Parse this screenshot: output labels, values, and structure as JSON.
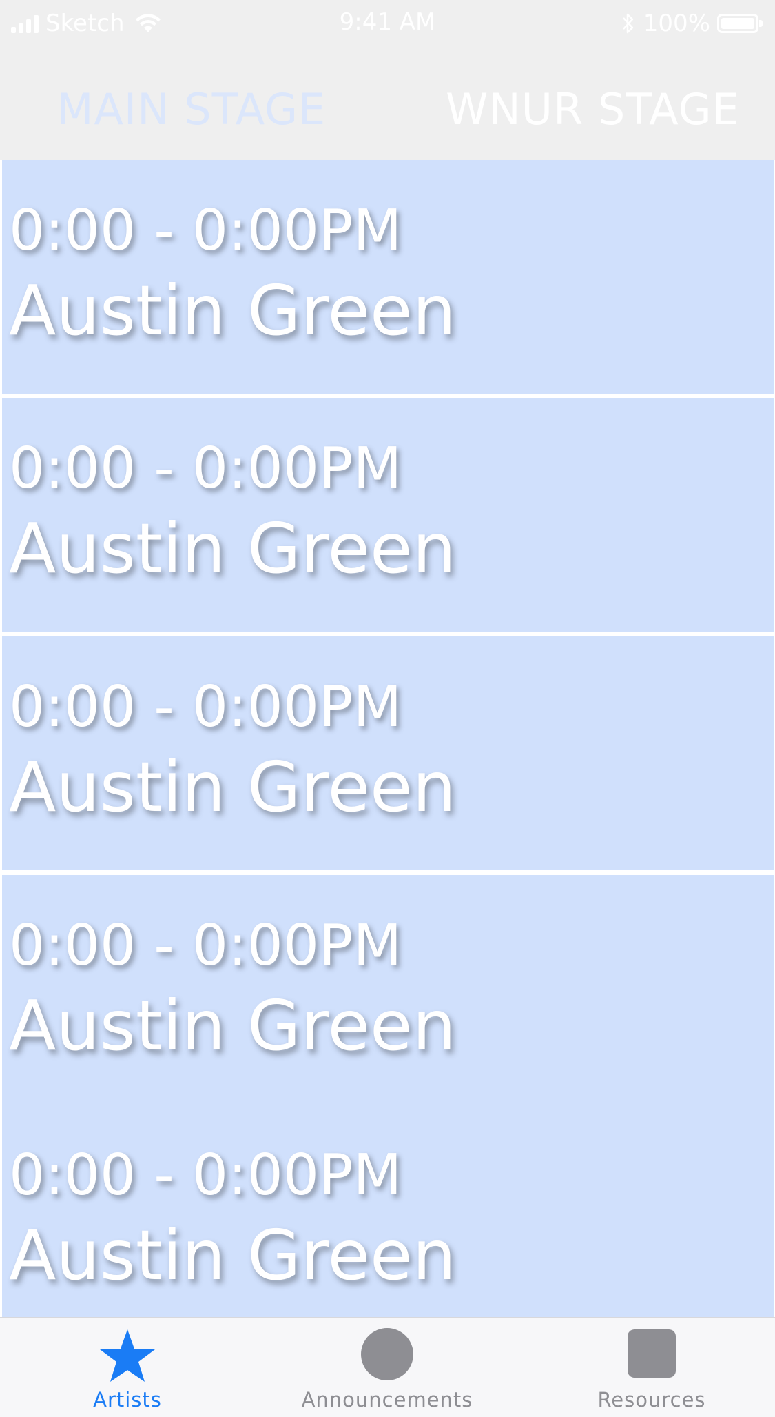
{
  "status_bar": {
    "carrier": "Sketch",
    "time": "9:41 AM",
    "battery_percent": "100%",
    "battery_level": 1.0
  },
  "stage_tabs": {
    "main_label": "MAIN STAGE",
    "wnur_label": "WNUR STAGE"
  },
  "schedule": [
    {
      "time": "0:00 - 0:00PM",
      "artist": "Austin Green"
    },
    {
      "time": "0:00 - 0:00PM",
      "artist": "Austin Green"
    },
    {
      "time": "0:00 - 0:00PM",
      "artist": "Austin Green"
    },
    {
      "time": "0:00 - 0:00PM",
      "artist": "Austin Green"
    },
    {
      "time": "0:00 - 0:00PM",
      "artist": "Austin Green"
    }
  ],
  "tab_bar": {
    "artists_label": "Artists",
    "announcements_label": "Announcements",
    "resources_label": "Resources",
    "artists_icon": "star-icon",
    "announcements_icon": "circle-icon",
    "resources_icon": "square-icon"
  },
  "colors": {
    "row_background": "#d0e0fc",
    "active_tab": "#1a7cf5",
    "inactive_tab": "#8e8e93",
    "header_background": "#efefef"
  }
}
